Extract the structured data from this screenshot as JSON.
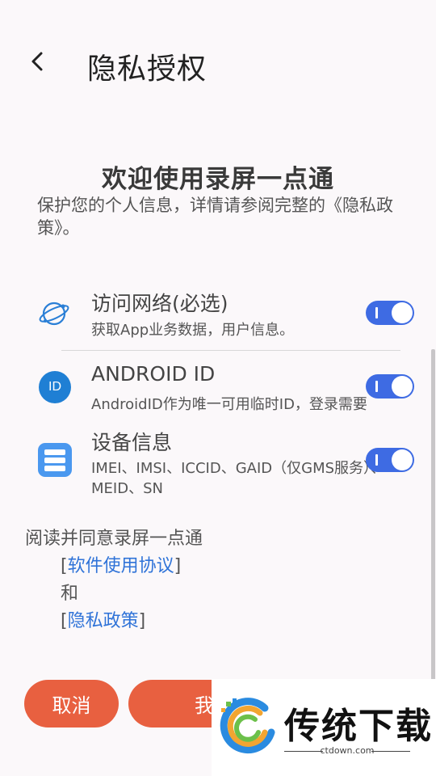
{
  "header": {
    "title": "隐私授权"
  },
  "welcome": "欢迎使用录屏一点通",
  "intro": "保护您的个人信息，详情请参阅完整的《隐私政策》。",
  "permissions": [
    {
      "title": "访问网络(必选)",
      "desc": "获取App业务数据，用户信息。",
      "icon": "globe-icon",
      "enabled": true
    },
    {
      "title": "ANDROID ID",
      "desc": "AndroidID作为唯一可用临时ID，登录需要",
      "icon": "id-icon",
      "icon_text": "ID",
      "enabled": true
    },
    {
      "title": "设备信息",
      "desc": "IMEI、IMSI、ICCID、GAID（仅GMS服务）、MEID、SN",
      "icon": "device-storage-icon",
      "enabled": true
    }
  ],
  "agreement": {
    "prefix": "阅读并同意录屏一点通",
    "bracket_open": "[",
    "bracket_close": "]",
    "software_link": "软件使用协议",
    "and": "和",
    "privacy_link": "隐私政策"
  },
  "buttons": {
    "cancel": "取消",
    "agree_partial": "我"
  },
  "watermark": {
    "brand": "传统下载",
    "url": "ctdown.com"
  },
  "colors": {
    "accent": "#3e6be3",
    "button": "#e86040",
    "link": "#2f73d8",
    "icon_blue": "#1f7fd4",
    "icon_device": "#4a98ef"
  }
}
